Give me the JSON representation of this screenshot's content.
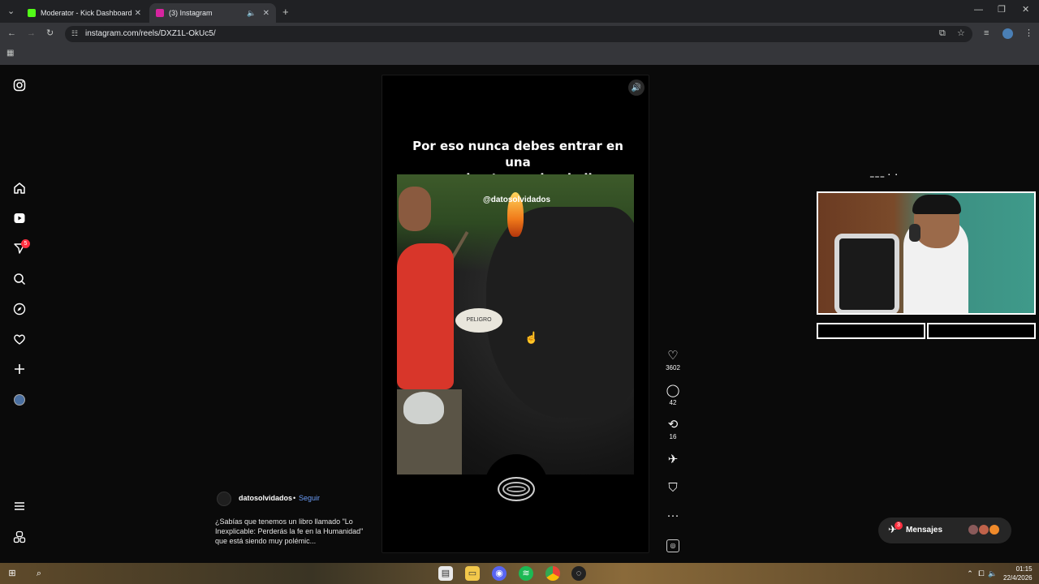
{
  "browser": {
    "tabs": [
      {
        "label": "Moderator - Kick Dashboard",
        "favicon_color": "#53fc18"
      },
      {
        "label": "(3) Instagram",
        "favicon_color": "#d6249f"
      }
    ],
    "url": "instagram.com/reels/DXZ1L-OkUc5/"
  },
  "sidebar": {
    "notifications_badge": "5",
    "icons": [
      "instagram-icon",
      "home-icon",
      "reels-icon",
      "messages-icon",
      "search-icon",
      "explore-icon",
      "heart-icon",
      "create-icon",
      "profile-icon",
      "menu-icon",
      "threads-icon"
    ]
  },
  "reel": {
    "title": "Por eso nunca debes entrar en una\ncueva si antes probar la llama",
    "watermark": "@datosolvidados",
    "sign_text": "PELIGRO"
  },
  "actions": {
    "likes": "3602",
    "comments": "42",
    "reposts": "16"
  },
  "caption": {
    "author": "datosolvidados",
    "separator": "•",
    "follow_label": "Seguir",
    "text": "¿Sabías que tenemos un libro llamado \"Lo Inexplicable: Perderás la fe en la Humanidad\" que está siendo muy polémic..."
  },
  "messages": {
    "label": "Mensajes",
    "badge": "3",
    "avatar_colors": [
      "#8a5a5a",
      "#c0624a",
      "#f08a2a"
    ]
  },
  "taskbar": {
    "time": "01:15",
    "date": "22/4/2026"
  },
  "colors": {
    "accent_link": "#6b9cf6",
    "badge_red": "#ff3040"
  }
}
